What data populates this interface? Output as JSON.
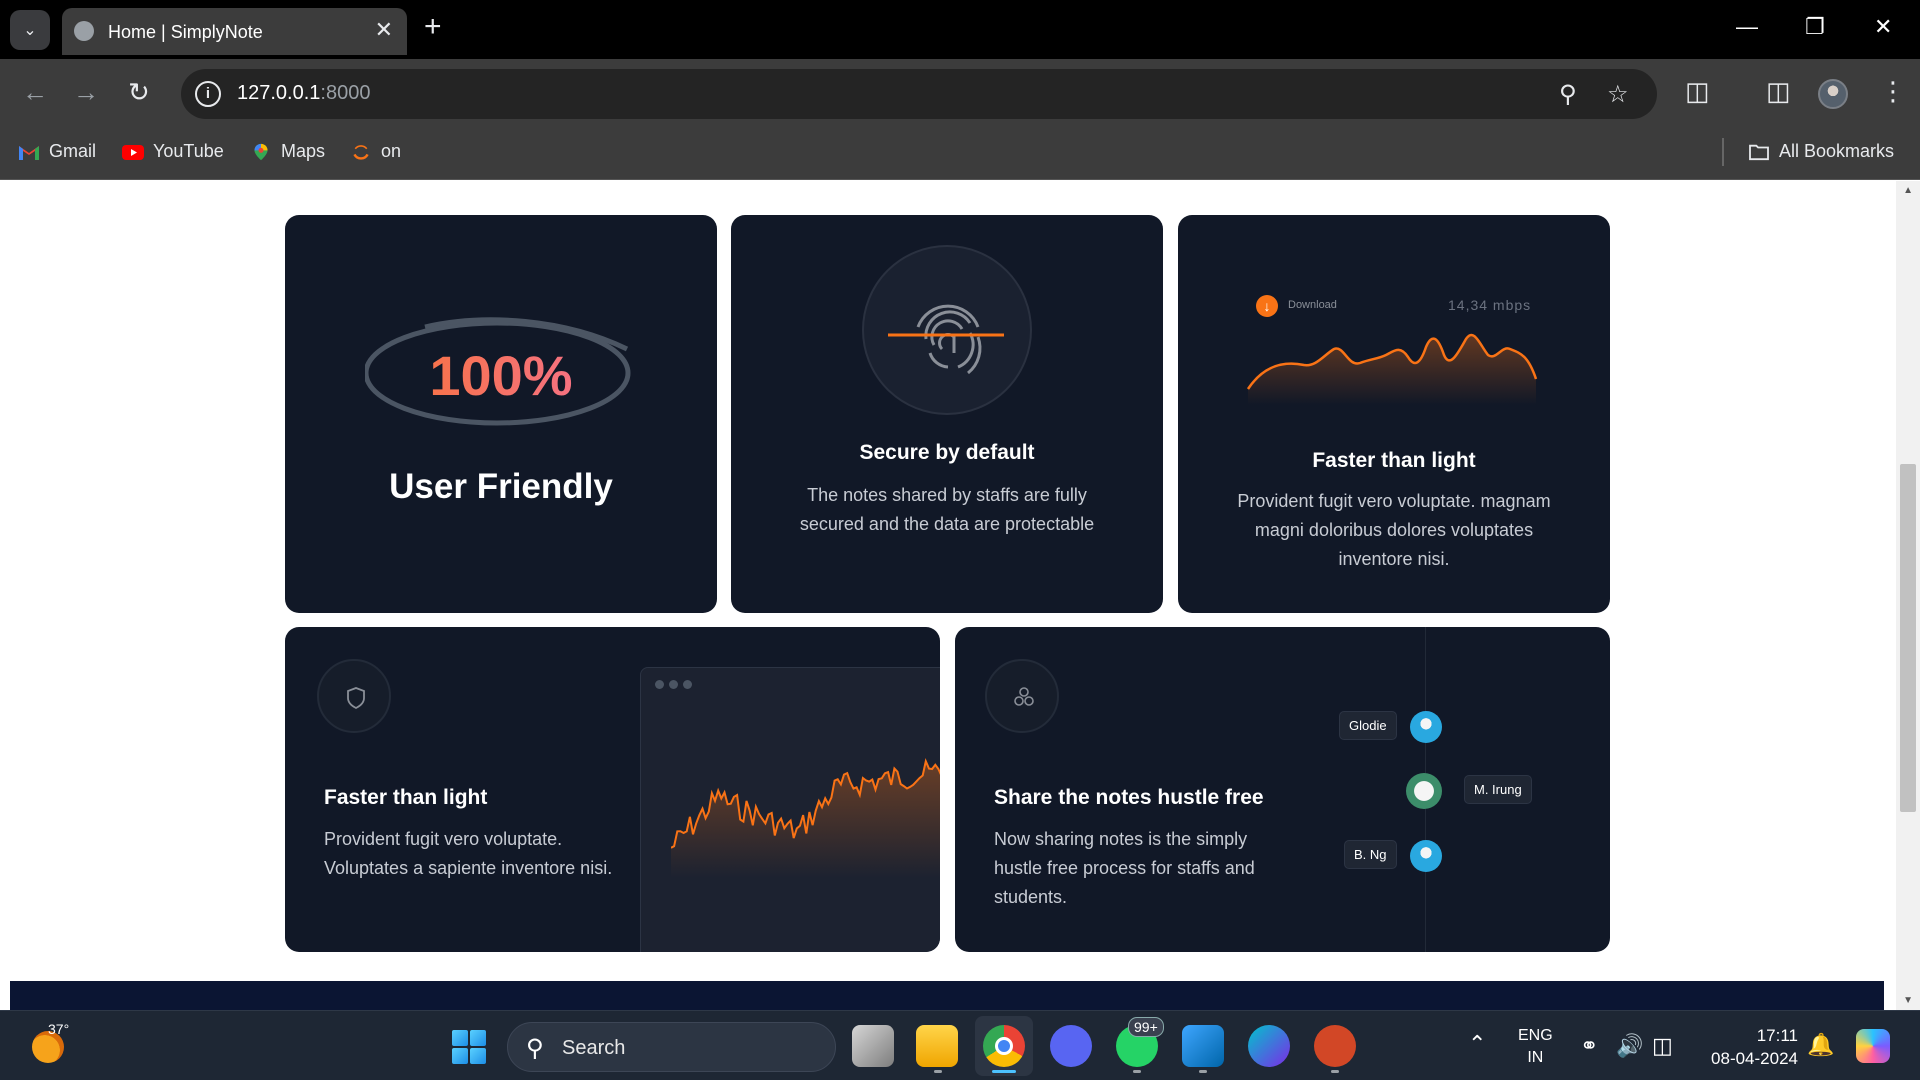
{
  "browser": {
    "tab_title": "Home | SimplyNote",
    "url_host": "127.0.0.1",
    "url_port": ":8000",
    "bookmarks": [
      {
        "label": "Gmail",
        "icon": "gmail-icon"
      },
      {
        "label": "YouTube",
        "icon": "youtube-icon"
      },
      {
        "label": "Maps",
        "icon": "maps-icon"
      },
      {
        "label": "on",
        "icon": "bookmark-site-icon"
      }
    ],
    "all_bookmarks": "All Bookmarks"
  },
  "cards": {
    "user_friendly": {
      "percent": "100%",
      "title": "User Friendly"
    },
    "secure": {
      "title": "Secure by default",
      "text": "The notes shared by staffs are fully secured and the data are protectable"
    },
    "faster_top": {
      "download_label": "Download",
      "speed": "14,34 mbps",
      "title": "Faster than light",
      "text": "Provident fugit vero voluptate. magnam magni doloribus dolores voluptates inventore nisi."
    },
    "faster_bottom": {
      "title": "Faster than light",
      "text": "Provident fugit vero voluptate. Voluptates a sapiente inventore nisi."
    },
    "share": {
      "title": "Share the notes hustle free",
      "text": "Now sharing notes is the simply hustle free process for staffs and students.",
      "users": [
        "Glodie",
        "M. Irung",
        "B. Ng"
      ]
    }
  },
  "taskbar": {
    "temperature": "37°",
    "search_label": "Search",
    "whatsapp_badge": "99+",
    "lang_top": "ENG",
    "lang_bottom": "IN",
    "time": "17:11",
    "date": "08-04-2024"
  },
  "colors": {
    "card_bg": "#111827",
    "accent_orange": "#f97316",
    "gradient_pink": "#f472b6"
  }
}
